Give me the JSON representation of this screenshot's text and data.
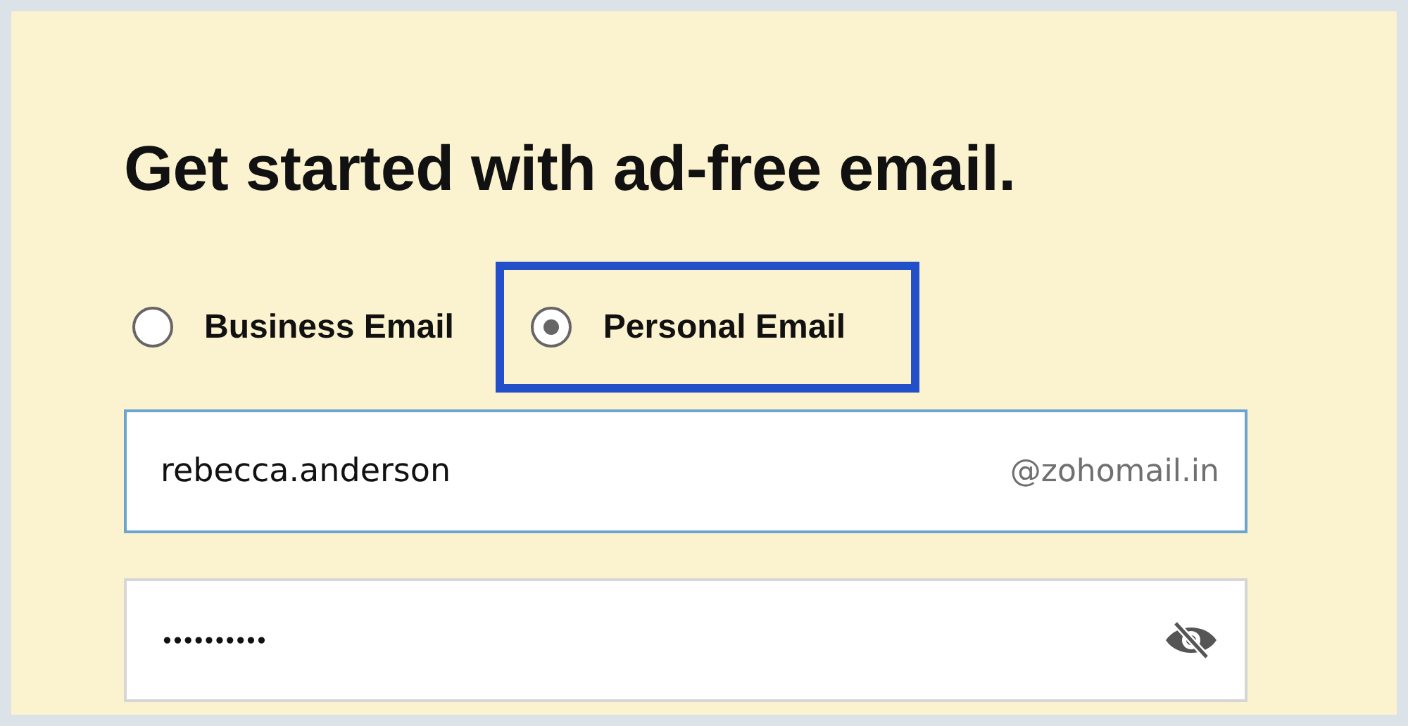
{
  "heading": "Get started with ad-free email.",
  "account_types": [
    {
      "label": "Business Email",
      "selected": false,
      "highlighted": false
    },
    {
      "label": "Personal Email",
      "selected": true,
      "highlighted": true
    }
  ],
  "email_field": {
    "value": "rebecca.anderson",
    "domain": "@zohomail.in",
    "focused": true
  },
  "password_field": {
    "value": "••••••••••"
  }
}
